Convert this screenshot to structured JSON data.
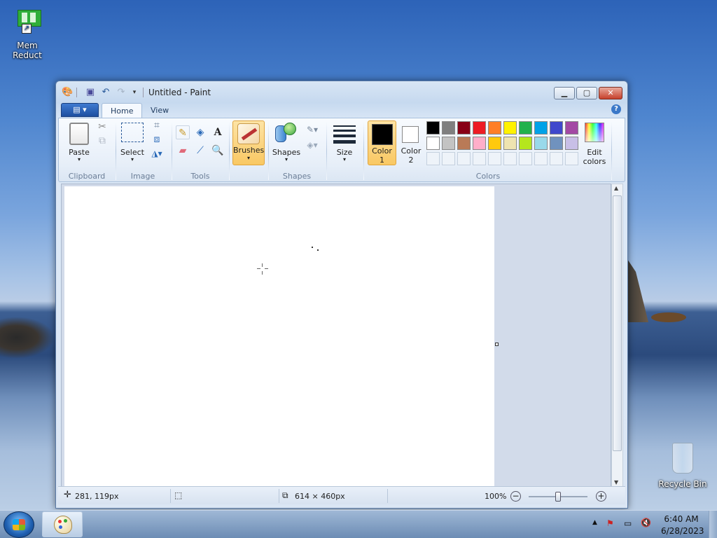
{
  "desktop": {
    "icons": [
      {
        "label": "Mem Reduct"
      },
      {
        "label": "Recycle Bin"
      }
    ]
  },
  "window": {
    "title": "Untitled - Paint",
    "quick_access": [
      "save-icon",
      "undo-icon",
      "redo-icon",
      "customize-icon"
    ]
  },
  "tabs": {
    "file": "▤ ▾",
    "home": "Home",
    "view": "View",
    "help": "?"
  },
  "ribbon": {
    "clipboard": {
      "paste": "Paste",
      "group": "Clipboard"
    },
    "image": {
      "select": "Select",
      "group": "Image"
    },
    "tools": {
      "group": "Tools",
      "text_glyph": "A"
    },
    "brushes": {
      "label": "Brushes"
    },
    "shapes": {
      "label": "Shapes",
      "group": "Shapes"
    },
    "size": {
      "label": "Size"
    },
    "color1": {
      "line1": "Color",
      "line2": "1"
    },
    "color2": {
      "line1": "Color",
      "line2": "2"
    },
    "colors": {
      "group": "Colors",
      "row1": [
        "#000000",
        "#7f7f7f",
        "#880015",
        "#ed1c24",
        "#ff7f27",
        "#fff200",
        "#22b14c",
        "#00a2e8",
        "#3f48cc",
        "#a349a4"
      ],
      "row2": [
        "#ffffff",
        "#c3c3c3",
        "#b97a57",
        "#ffaec9",
        "#ffc90e",
        "#efe4b0",
        "#b5e61d",
        "#99d9ea",
        "#7092be",
        "#c8bfe7"
      ]
    },
    "edit_colors": {
      "line1": "Edit",
      "line2": "colors"
    }
  },
  "status": {
    "cursor": "281, 119px",
    "canvas_size": "614 × 460px",
    "zoom": "100%"
  },
  "taskbar": {
    "time": "6:40 AM",
    "date": "6/28/2023"
  }
}
